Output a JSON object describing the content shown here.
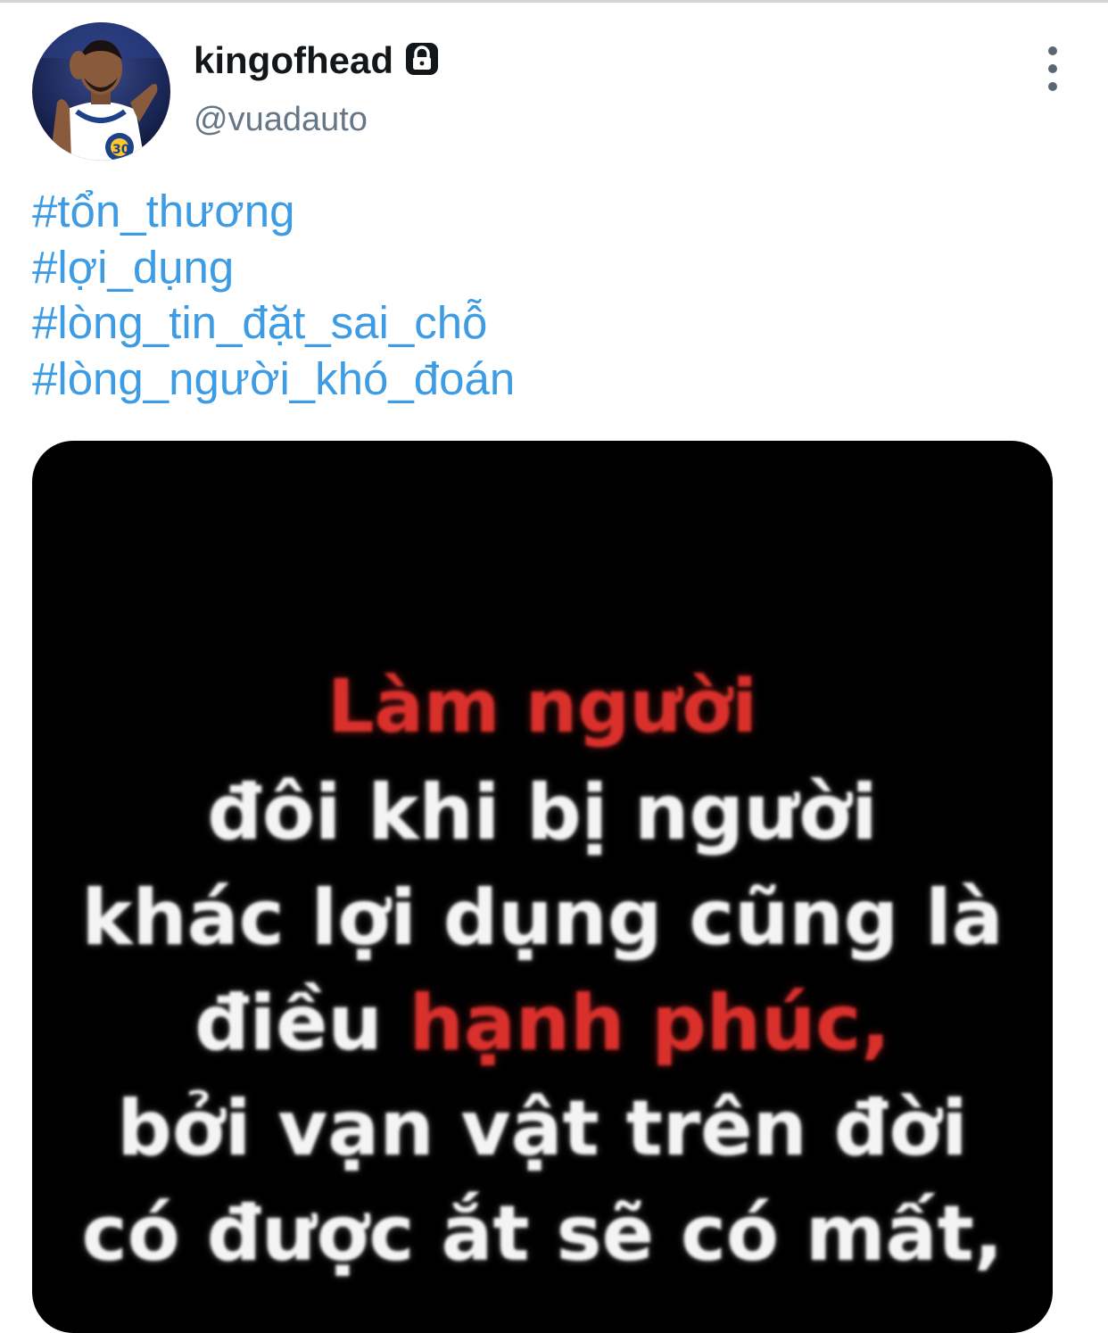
{
  "tweet": {
    "author": {
      "display_name": "kingofhead",
      "handle": "@vuadauto",
      "protected_icon": "lock-icon",
      "avatar_icon": "avatar"
    },
    "more_icon": "more-vertical-icon",
    "hashtags": [
      "#tổn_thương",
      "#lợi_dụng",
      "#lòng_tin_đặt_sai_chỗ",
      "#lòng_người_khó_đoán"
    ],
    "image": {
      "quote_lines": [
        {
          "text": "Làm người",
          "color": "red"
        },
        {
          "text": "đôi khi bị người",
          "color": "white"
        },
        {
          "text": "khác lợi dụng cũng là",
          "color": "white"
        },
        {
          "prefix": "điều ",
          "highlight": "hạnh phúc,",
          "color": "mixed"
        },
        {
          "text": "bởi vạn vật trên đời",
          "color": "white"
        },
        {
          "text": "có được ắt sẽ có mất,",
          "color": "white"
        }
      ],
      "colors": {
        "background": "#000000",
        "text": "#f4f4f4",
        "highlight": "#d9302c"
      }
    },
    "colors": {
      "hashtag": "#3d9ce3",
      "name": "#14171a",
      "handle": "#657786"
    }
  }
}
